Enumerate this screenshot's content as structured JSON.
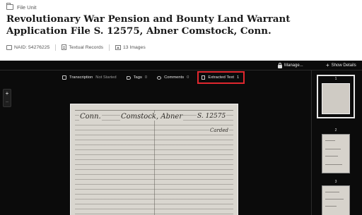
{
  "header": {
    "unit_label": "File Unit",
    "title": "Revolutionary War Pension and Bounty Land Warrant Application File S. 12575, Abner Comstock, Conn.",
    "naid": "NAID: 54276225",
    "record_type": "Textual Records",
    "image_count": "13 Images"
  },
  "viewer": {
    "manage_label": "Manage...",
    "show_details_label": "Show Details",
    "tabs": [
      {
        "label": "Transcription",
        "value": "Not Started"
      },
      {
        "label": "Tags",
        "value": "0"
      },
      {
        "label": "Comments",
        "value": "0"
      },
      {
        "label": "Extracted Text",
        "value": "1"
      }
    ],
    "zoom_in": "+",
    "zoom_out": "−",
    "document_handwriting": [
      "Conn.",
      "Comstock, Abner",
      "S. 12575",
      "Carded"
    ],
    "thumbnails": [
      "1",
      "2",
      "3"
    ],
    "highlight_color": "#e0272e"
  }
}
